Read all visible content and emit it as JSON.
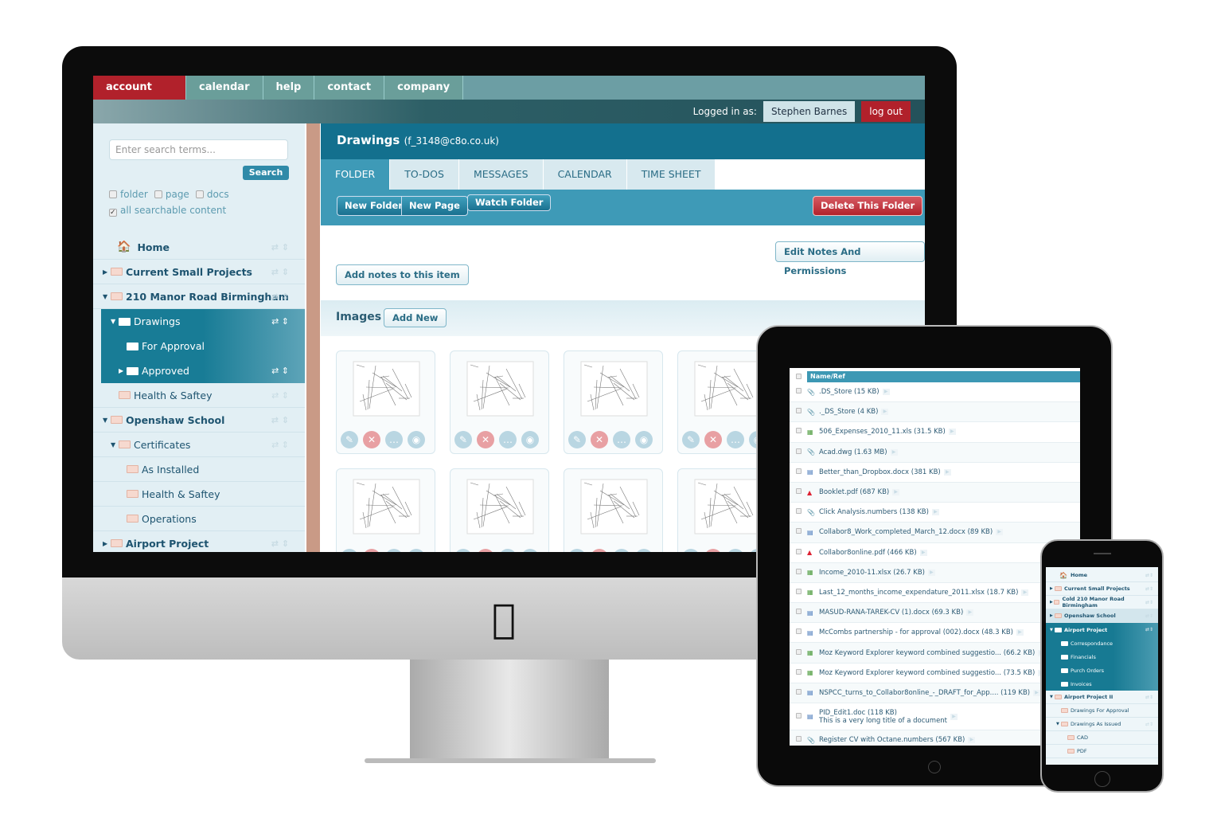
{
  "nav": {
    "tabs": [
      "account home",
      "calendar",
      "help",
      "contact",
      "company"
    ],
    "logged_in_label": "Logged in as:",
    "user": "Stephen Barnes",
    "logout": "log out"
  },
  "sidebar": {
    "search_placeholder": "Enter search terms...",
    "search_button": "Search",
    "filters": [
      {
        "label": "folder",
        "checked": false
      },
      {
        "label": "page",
        "checked": false
      },
      {
        "label": "docs",
        "checked": false
      }
    ],
    "all_content": {
      "label": "all searchable content",
      "checked": true
    },
    "tree": [
      {
        "label": "Home",
        "icon": "home-icon",
        "bold": true,
        "level": 0
      },
      {
        "label": "Current Small Projects",
        "bold": true,
        "level": 0,
        "arrow": "right"
      },
      {
        "label": "210 Manor Road Birmingham",
        "bold": true,
        "level": 0,
        "arrow": "down"
      },
      {
        "label": "Drawings",
        "level": 1,
        "arrow": "down",
        "selected": true
      },
      {
        "label": "For Approval",
        "level": 2,
        "selected": true
      },
      {
        "label": "Approved",
        "level": 2,
        "arrow": "right",
        "selected": true
      },
      {
        "label": "Health & Saftey",
        "level": 1
      },
      {
        "label": "Openshaw School",
        "bold": true,
        "level": 0,
        "arrow": "down"
      },
      {
        "label": "Certificates",
        "level": 1,
        "arrow": "down"
      },
      {
        "label": "As Installed",
        "level": 2
      },
      {
        "label": "Health & Saftey",
        "level": 2
      },
      {
        "label": "Operations",
        "level": 2
      },
      {
        "label": "Airport Project",
        "bold": true,
        "level": 0,
        "arrow": "right"
      }
    ]
  },
  "main": {
    "title": "Drawings",
    "subtitle": "(f_3148@c8o.co.uk)",
    "tabs": [
      "FOLDER",
      "TO-DOS",
      "MESSAGES",
      "CALENDAR",
      "TIME SHEET"
    ],
    "active_tab": "FOLDER",
    "toolbar": {
      "new_folder": "New Folder",
      "new_page": "New Page",
      "watch_folder": "Watch Folder",
      "delete_folder": "Delete This Folder"
    },
    "edit_notes": "Edit Notes And Permissions",
    "add_notes": "Add notes to this item",
    "images_label": "Images",
    "add_new": "Add New",
    "image_count_visible": 8
  },
  "tablet": {
    "column_header": "Name/Ref",
    "files": [
      {
        "name": ".DS_Store (15 KB)",
        "type": "attachment"
      },
      {
        "name": "._DS_Store (4 KB)",
        "type": "attachment"
      },
      {
        "name": "506_Expenses_2010_11.xls (31.5 KB)",
        "type": "spreadsheet"
      },
      {
        "name": "Acad.dwg (1.63 MB)",
        "type": "attachment"
      },
      {
        "name": "Better_than_Dropbox.docx (381 KB)",
        "type": "document"
      },
      {
        "name": "Booklet.pdf (687 KB)",
        "type": "pdf"
      },
      {
        "name": "Click Analysis.numbers (138 KB)",
        "type": "attachment"
      },
      {
        "name": "Collabor8_Work_completed_March_12.docx (89 KB)",
        "type": "document"
      },
      {
        "name": "Collabor8online.pdf (466 KB)",
        "type": "pdf"
      },
      {
        "name": "Income_2010-11.xlsx (26.7 KB)",
        "type": "spreadsheet"
      },
      {
        "name": "Last_12_months_income_expendature_2011.xlsx (18.7 KB)",
        "type": "spreadsheet"
      },
      {
        "name": "MASUD-RANA-TAREK-CV (1).docx (69.3 KB)",
        "type": "document"
      },
      {
        "name": "McCombs partnership - for approval (002).docx (48.3 KB)",
        "type": "document"
      },
      {
        "name": "Moz Keyword Explorer keyword combined suggestio... (66.2 KB)",
        "type": "spreadsheet"
      },
      {
        "name": "Moz Keyword Explorer keyword combined suggestio... (73.5 KB)",
        "type": "spreadsheet"
      },
      {
        "name": "NSPCC_turns_to_Collabor8online_-_DRAFT_for_App.... (119 KB)",
        "type": "document"
      },
      {
        "name": "PID_Edit1.doc (118 KB)",
        "sub": "This is a very long title of a document",
        "type": "document"
      },
      {
        "name": "Register CV with Octane.numbers (567 KB)",
        "type": "attachment"
      }
    ]
  },
  "phone": {
    "tree": [
      {
        "label": "Home",
        "icon": "home-icon"
      },
      {
        "label": "Current Small Projects",
        "arrow": "right"
      },
      {
        "label": "Cold 210 Manor Road Birmingham",
        "arrow": "right"
      },
      {
        "label": "Openshaw School",
        "arrow": "right",
        "highlight": true
      },
      {
        "label": "Airport Project",
        "arrow": "down",
        "selected": true
      },
      {
        "label": "Correspondance",
        "level": 1,
        "selected": true
      },
      {
        "label": "Financials",
        "level": 1,
        "selected": true
      },
      {
        "label": "Purch Orders",
        "level": 1,
        "selected": true
      },
      {
        "label": "Invoices",
        "level": 1,
        "selected": true
      },
      {
        "label": "Airport Project II",
        "arrow": "down"
      },
      {
        "label": "Drawings For Approval",
        "level": 1
      },
      {
        "label": "Drawings As Issued",
        "level": 1,
        "arrow": "down"
      },
      {
        "label": "CAD",
        "level": 2
      },
      {
        "label": "PDF",
        "level": 2
      }
    ]
  },
  "colors": {
    "brand_red": "#b1212b",
    "teal_dark": "#13708e",
    "teal": "#3e9ab7",
    "sidebar_bg": "#e2eff4"
  }
}
